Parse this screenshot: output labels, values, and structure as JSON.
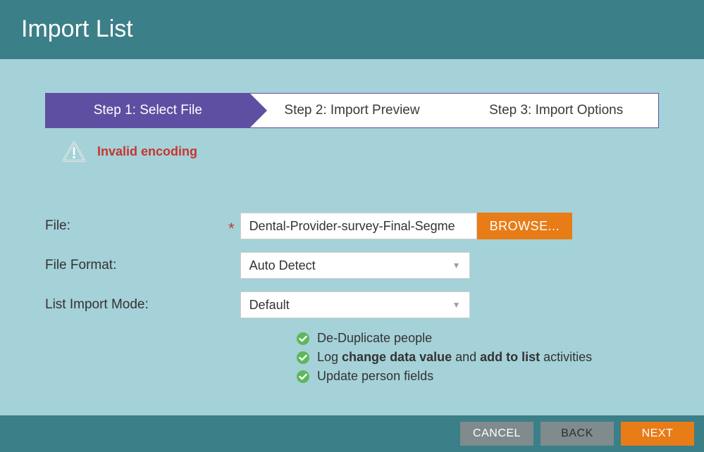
{
  "header": {
    "title": "Import List"
  },
  "stepper": {
    "steps": [
      {
        "label": "Step 1: Select File",
        "active": true
      },
      {
        "label": "Step 2: Import Preview",
        "active": false
      },
      {
        "label": "Step 3: Import Options",
        "active": false
      }
    ]
  },
  "error": {
    "message": "Invalid encoding"
  },
  "form": {
    "file_label": "File:",
    "file_value": "Dental-Provider-survey-Final-Segme",
    "browse_label": "BROWSE...",
    "file_format_label": "File Format:",
    "file_format_value": "Auto Detect",
    "list_import_mode_label": "List Import Mode:",
    "list_import_mode_value": "Default",
    "options": {
      "dedup": "De-Duplicate people",
      "log_prefix": "Log ",
      "log_bold1": "change data value",
      "log_mid": " and ",
      "log_bold2": "add to list",
      "log_suffix": " activities",
      "update": "Update person fields"
    }
  },
  "footer": {
    "cancel": "CANCEL",
    "back": "BACK",
    "next": "NEXT"
  },
  "colors": {
    "header_bg": "#3b7f88",
    "body_bg": "#a5d1d8",
    "accent_purple": "#5e4fa2",
    "accent_orange": "#e87c17",
    "error_red": "#c5362e",
    "success_green": "#5cb85c"
  },
  "icons": {
    "warning": "warning-triangle-icon",
    "check": "checkmark-circle-icon",
    "caret": "chevron-down-icon"
  }
}
